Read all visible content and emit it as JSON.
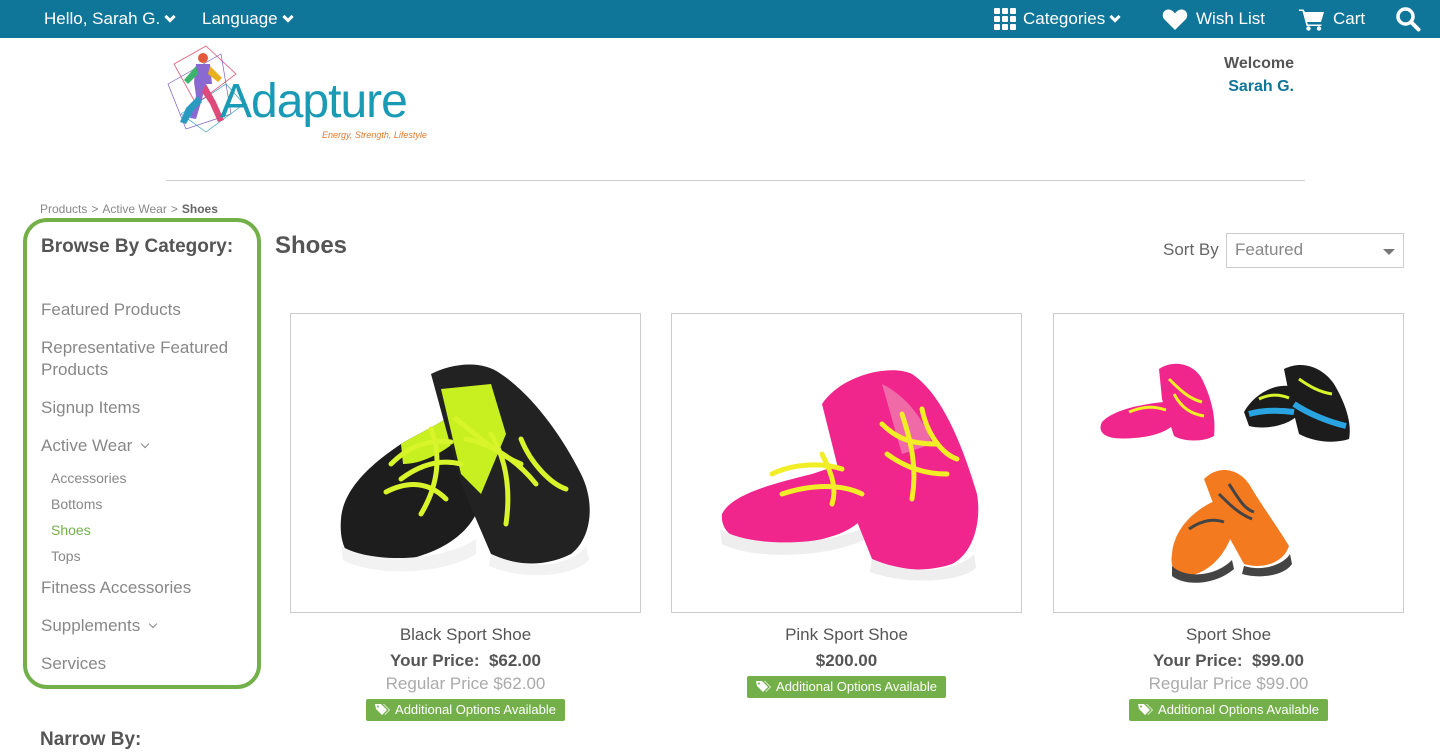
{
  "topbar": {
    "greeting": "Hello, Sarah G.",
    "language": "Language",
    "categories": "Categories",
    "wishlist": "Wish List",
    "cart": "Cart"
  },
  "header": {
    "logo_text": "Adapture",
    "logo_tagline": "Energy, Strength, Lifestyle",
    "welcome": "Welcome",
    "user": "Sarah G."
  },
  "breadcrumb": [
    "Products",
    "Active Wear",
    "Shoes"
  ],
  "sidebar": {
    "title": "Browse By Category:",
    "items": {
      "featured": "Featured Products",
      "rep_featured": "Representative Featured Products",
      "signup": "Signup Items",
      "active_wear": "Active Wear",
      "fitness": "Fitness Accessories",
      "supplements": "Supplements",
      "services": "Services"
    },
    "active_wear_children": [
      "Accessories",
      "Bottoms",
      "Shoes",
      "Tops"
    ],
    "narrow_title": "Narrow By:"
  },
  "main": {
    "title": "Shoes",
    "sort_label": "Sort By",
    "sort_value": "Featured"
  },
  "products": [
    {
      "name": "Black Sport Shoe",
      "price_label": "Your Price:",
      "price": "$62.00",
      "regular": "Regular Price $62.00",
      "badge": "Additional Options Available"
    },
    {
      "name": "Pink Sport Shoe",
      "price": "$200.00",
      "badge": "Additional Options Available"
    },
    {
      "name": "Sport Shoe",
      "price_label": "Your Price:",
      "price": "$99.00",
      "regular": "Regular Price $99.00",
      "badge": "Additional Options Available"
    }
  ],
  "colors": {
    "topbar": "#0f7699",
    "accent_green": "#74b04a"
  }
}
